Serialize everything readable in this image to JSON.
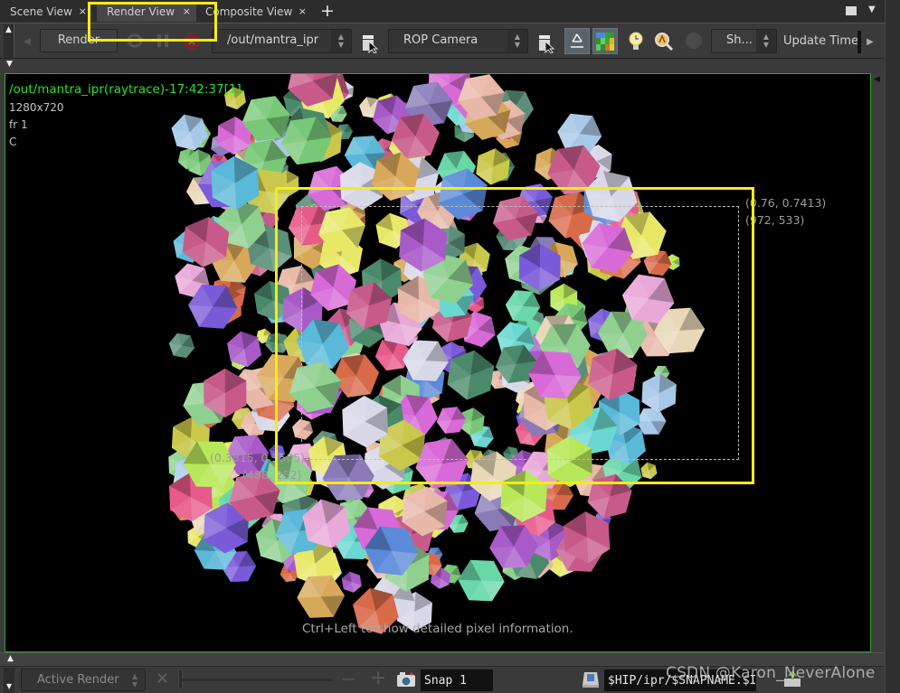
{
  "tabs": [
    {
      "label": "Scene View",
      "active": false
    },
    {
      "label": "Render View",
      "active": true
    },
    {
      "label": "Composite View",
      "active": false
    }
  ],
  "tab_close_glyph": "×",
  "tab_add_glyph": "+",
  "toolbar": {
    "render_label": "Render",
    "rop_path": "/out/mantra_ipr",
    "camera": "ROP Camera",
    "shading": "Sh...",
    "update_time_label": "Update Time",
    "icons": [
      "left-arrow-icon",
      "refresh-icon",
      "pause-icon",
      "stop-icon",
      "pick-rop-icon",
      "pick-camera-icon",
      "recycle-icon",
      "bucket-preview-icon",
      "render-region-timer-icon",
      "inspect-icon",
      "sphere-preview-icon",
      "right-arrow-icon"
    ]
  },
  "viewport": {
    "title": "/out/mantra_ipr(raytrace)-17:42:37[1]",
    "resolution": "1280x720",
    "frame": "fr 1",
    "channel": "C",
    "top_right_uv": "(0.76, 0.7413)",
    "top_right_px": "(972, 533)",
    "bottom_left_uv": "(0.3815, 0.3505)",
    "bottom_left_px": "(488, 252)",
    "hint": "Ctrl+Left to show detailed pixel information.",
    "title_color": "#2ce02c",
    "border_color": "#2fa42f",
    "highlight_color": "#f5ec14"
  },
  "bottom": {
    "snapshot_mode": "Active Render",
    "snap_name": "Snap 1",
    "snap_path": "$HIP/ipr/$SNAPNAME.$I",
    "minus": "−",
    "plus": "+",
    "close": "×"
  },
  "watermark": "CSDN @Karon_NeverAlone"
}
